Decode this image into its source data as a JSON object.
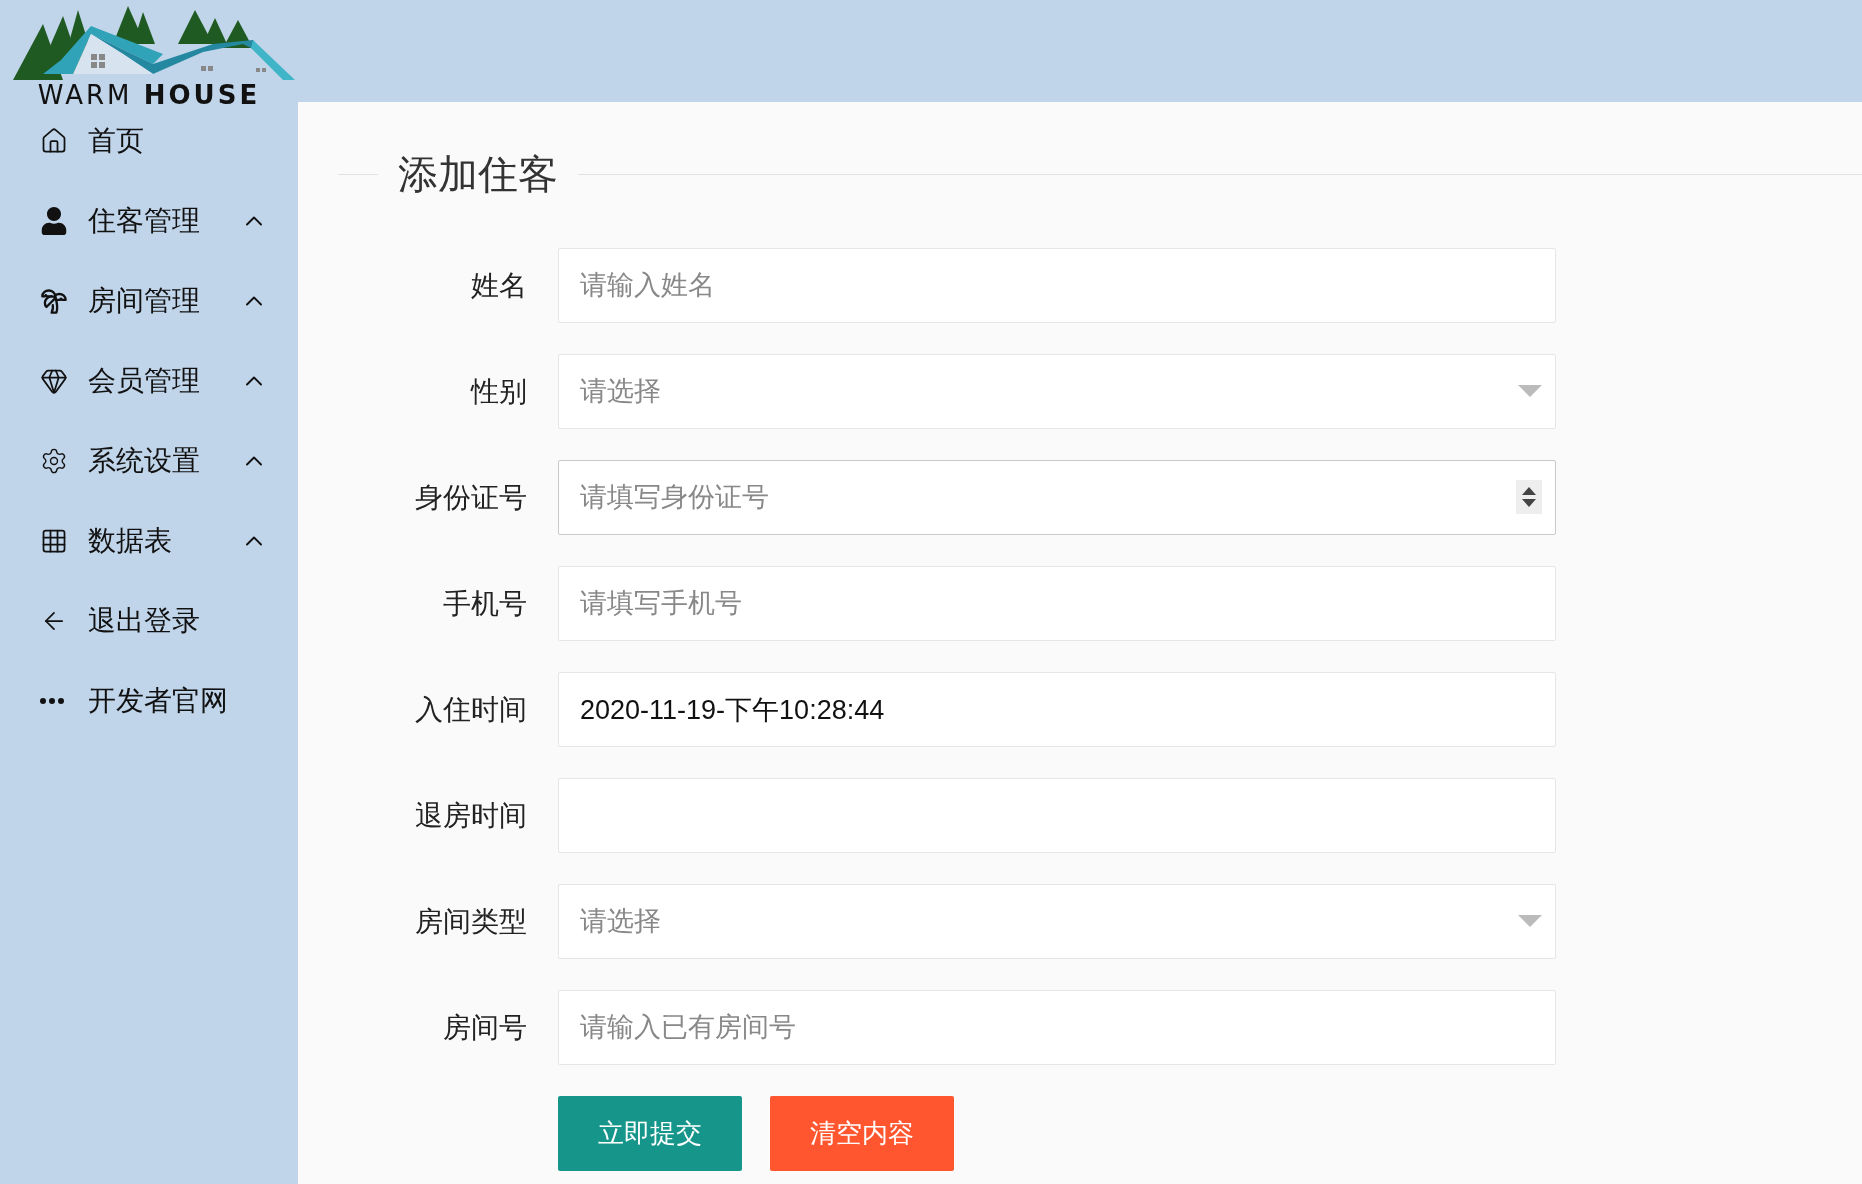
{
  "logo": {
    "text": "WARM **HOUSE**"
  },
  "sidebar": {
    "items": [
      {
        "label": "首页",
        "kind": "link"
      },
      {
        "label": "住客管理",
        "kind": "group"
      },
      {
        "label": "房间管理",
        "kind": "group"
      },
      {
        "label": "会员管理",
        "kind": "group"
      },
      {
        "label": "系统设置",
        "kind": "group"
      },
      {
        "label": "数据表",
        "kind": "group"
      },
      {
        "label": "退出登录",
        "kind": "link"
      },
      {
        "label": "开发者官网",
        "kind": "link"
      }
    ]
  },
  "form": {
    "title": "添加住客",
    "fields": [
      {
        "label": "姓名",
        "kind": "text",
        "placeholder": "请输入姓名"
      },
      {
        "label": "性别",
        "kind": "select",
        "placeholder": "请选择"
      },
      {
        "label": "身份证号",
        "kind": "number",
        "placeholder": "请填写身份证号"
      },
      {
        "label": "手机号",
        "kind": "text",
        "placeholder": "请填写手机号"
      },
      {
        "label": "入住时间",
        "kind": "text",
        "value": "2020-11-19-下午10:28:44"
      },
      {
        "label": "退房时间",
        "kind": "text"
      },
      {
        "label": "房间类型",
        "kind": "select",
        "placeholder": "请选择"
      },
      {
        "label": "房间号",
        "kind": "text",
        "placeholder": "请输入已有房间号"
      }
    ],
    "buttons": [
      {
        "label": "立即提交",
        "kind": "primary"
      },
      {
        "label": "清空内容",
        "kind": "danger"
      }
    ]
  }
}
